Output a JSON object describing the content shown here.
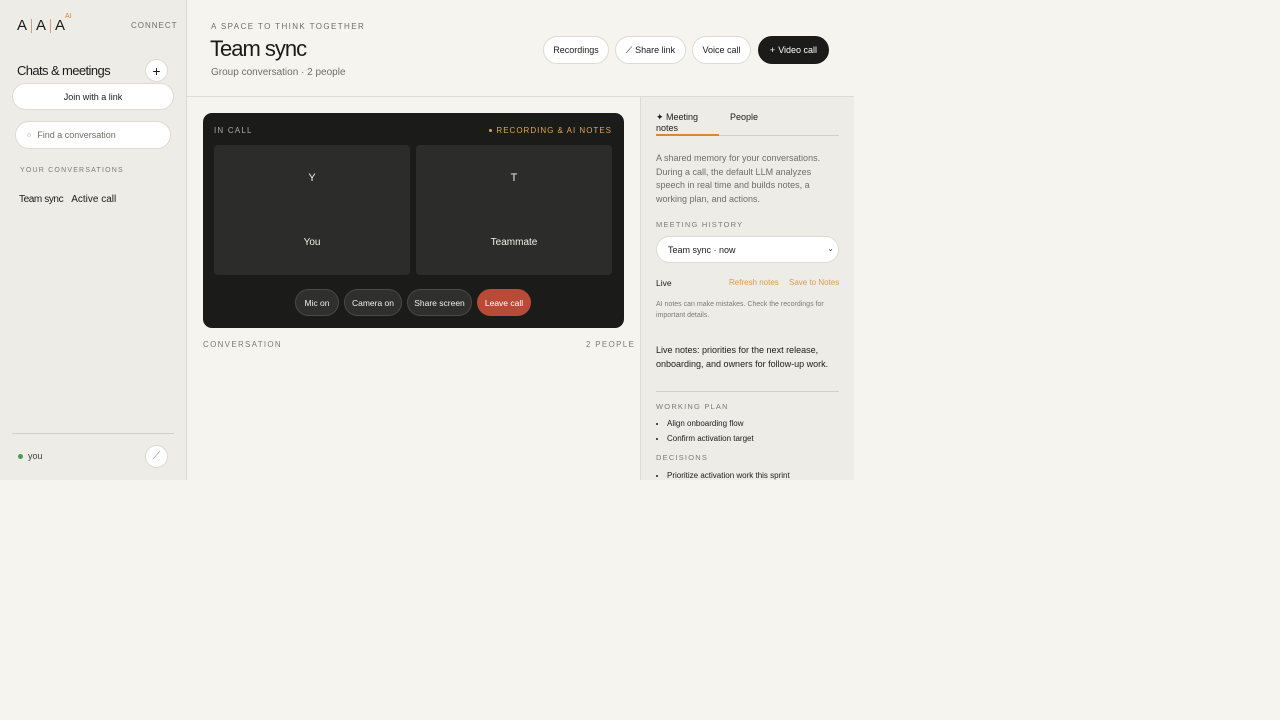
{
  "brand": {
    "letters": [
      "A",
      "A",
      "A"
    ],
    "superscript": "AI",
    "accent_color": "#d08a3b"
  },
  "sidebar": {
    "connect_label": "CONNECT",
    "title": "Chats & meetings",
    "add_icon": "plus-icon",
    "join_label": "Join with a link",
    "search_placeholder": "Find a conversation",
    "section_label": "YOUR CONVERSATIONS",
    "conversations": [
      {
        "name": "Team sync",
        "status": "Active call"
      }
    ],
    "user": {
      "name": "you",
      "status_color": "#4b9a4e"
    },
    "edit_icon": "pencil-icon"
  },
  "header": {
    "kicker": "A SPACE TO THINK TOGETHER",
    "title": "Team sync",
    "subtitle": "Group conversation · 2 people",
    "buttons": {
      "recordings": "Recordings",
      "share": "Share link",
      "voice": "Voice call",
      "video": "Video call"
    }
  },
  "call": {
    "status": "IN CALL",
    "recording": "RECORDING & AI NOTES",
    "recording_color": "#e3a35a",
    "participants": [
      {
        "initial": "Y",
        "label": "You"
      },
      {
        "initial": "T",
        "label": "Teammate"
      }
    ],
    "controls": {
      "mic": "Mic on",
      "camera": "Camera on",
      "share": "Share screen",
      "leave": "Leave call"
    },
    "leave_color": "#b94a37"
  },
  "conversation": {
    "label": "CONVERSATION",
    "people_count": "2 PEOPLE"
  },
  "panel": {
    "tabs": {
      "notes": "✦ Meeting notes",
      "people": "People"
    },
    "description": "A shared memory for your conversations. During a call, the default LLM analyzes speech in real time and builds notes, a working plan, and actions.",
    "history_label": "MEETING HISTORY",
    "history_selected": "Team sync · now",
    "live_label": "Live",
    "refresh_label": "Refresh notes",
    "save_label": "Save to Notes",
    "disclaimer": "AI notes can make mistakes. Check the recordings for important details.",
    "live_notes": "Live notes: priorities for the next release, onboarding, and owners for follow-up work.",
    "working_plan_label": "WORKING PLAN",
    "working_plan": [
      "Align onboarding flow",
      "Confirm activation target"
    ],
    "decisions_label": "DECISIONS",
    "decisions": [
      "Prioritize activation work this sprint"
    ]
  }
}
